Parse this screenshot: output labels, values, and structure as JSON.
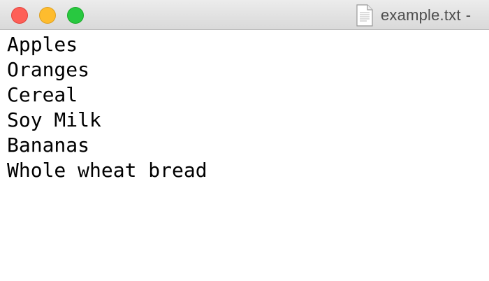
{
  "window": {
    "title": "example.txt",
    "title_suffix": "-"
  },
  "icons": {
    "close": "close-button",
    "minimize": "minimize-button",
    "zoom": "zoom-button",
    "document": "document-icon"
  },
  "colors": {
    "close": "#fe5f57",
    "minimize": "#febc2e",
    "zoom": "#28c840"
  },
  "editor": {
    "lines": [
      "Apples",
      "Oranges",
      "Cereal",
      "Soy Milk",
      "Bananas",
      "Whole wheat bread"
    ]
  }
}
